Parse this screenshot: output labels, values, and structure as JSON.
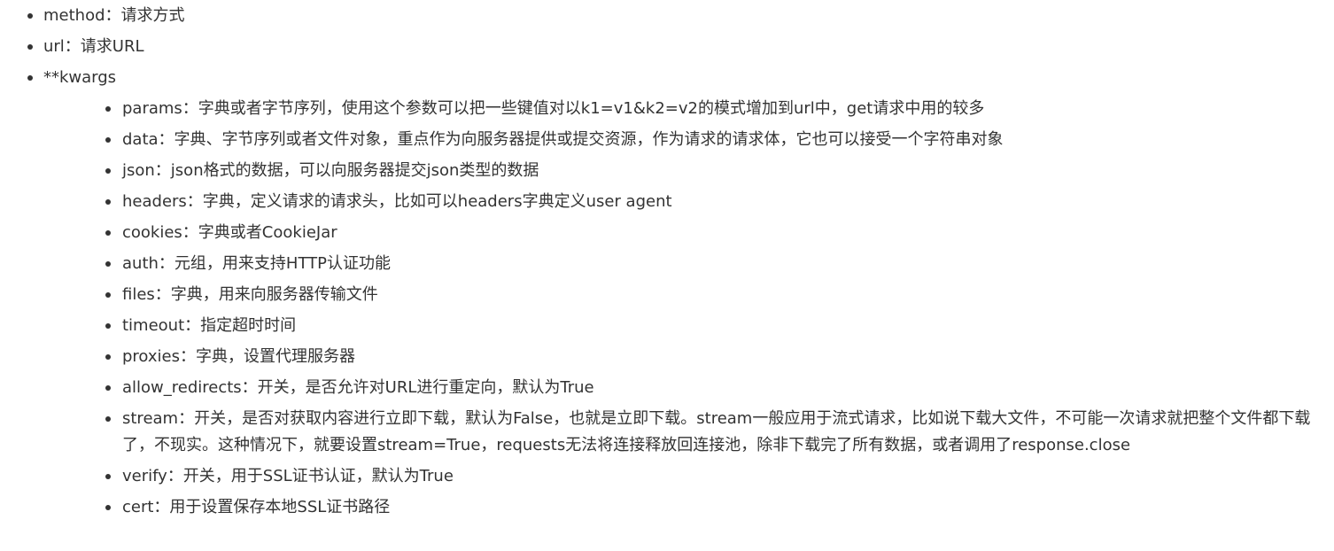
{
  "items": [
    {
      "text": "method：请求方式"
    },
    {
      "text": "url：请求URL"
    },
    {
      "text": "**kwargs"
    }
  ],
  "kwargs": [
    {
      "text": "params：字典或者字节序列，使用这个参数可以把一些键值对以k1=v1&k2=v2的模式增加到url中，get请求中用的较多"
    },
    {
      "text": "data：字典、字节序列或者文件对象，重点作为向服务器提供或提交资源，作为请求的请求体，它也可以接受一个字符串对象"
    },
    {
      "text": "json：json格式的数据，可以向服务器提交json类型的数据"
    },
    {
      "text": "headers：字典，定义请求的请求头，比如可以headers字典定义user agent"
    },
    {
      "text": "cookies：字典或者CookieJar"
    },
    {
      "text": "auth：元组，用来支持HTTP认证功能"
    },
    {
      "text": "files：字典，用来向服务器传输文件"
    },
    {
      "text": "timeout：指定超时时间"
    },
    {
      "text": "proxies：字典，设置代理服务器"
    },
    {
      "text": "allow_redirects：开关，是否允许对URL进行重定向，默认为True"
    },
    {
      "text": "stream：开关，是否对获取内容进行立即下载，默认为False，也就是立即下载。stream一般应用于流式请求，比如说下载大文件，不可能一次请求就把整个文件都下载了，不现实。这种情况下，就要设置stream=True，requests无法将连接释放回连接池，除非下载完了所有数据，或者调用了response.close"
    },
    {
      "text": "verify：开关，用于SSL证书认证，默认为True"
    },
    {
      "text": "cert：用于设置保存本地SSL证书路径"
    }
  ]
}
